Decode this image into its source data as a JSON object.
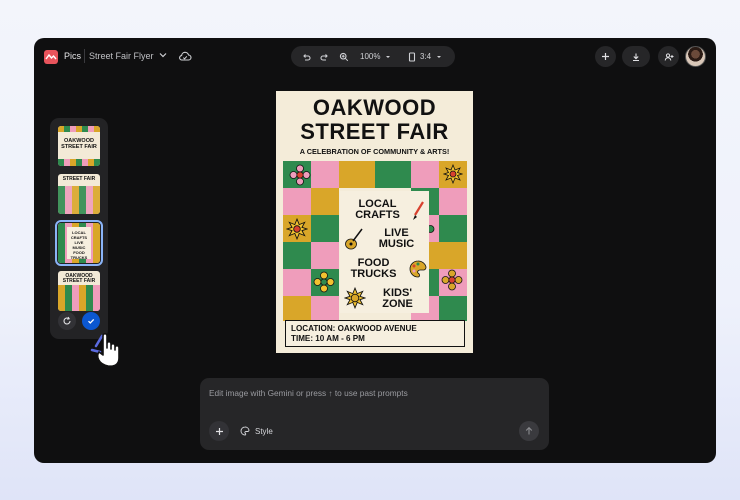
{
  "header": {
    "app_name": "Pics",
    "doc_title": "Street Fair Flyer",
    "zoom": "100%",
    "aspect": "3:4"
  },
  "icons": {
    "logo": "pics-logo-icon",
    "doc_menu": "chevron-down-icon",
    "sync": "cloud-icon",
    "undo": "undo-icon",
    "redo": "redo-icon",
    "zoom": "zoom-in-icon",
    "aspect": "portrait-icon",
    "add": "plus-icon",
    "download": "download-icon",
    "share": "add-person-icon",
    "regenerate": "refresh-icon",
    "apply": "check-icon",
    "send": "arrow-up-icon",
    "style": "palette-icon"
  },
  "thumbnails": [
    {
      "title": "OAKWOOD STREET FAIR",
      "selected": false
    },
    {
      "title": "STREET FAIR",
      "selected": false
    },
    {
      "title": "LOCAL CRAFTS LIVE MUSIC FOOD TRUCKS",
      "selected": true
    },
    {
      "title": "OAKWOOD STREET FAIR",
      "selected": false
    }
  ],
  "flyer": {
    "title_line1": "OAKWOOD",
    "title_line2": "STREET FAIR",
    "subtitle": "A CELEBRATION OF COMMUNITY & ARTS!",
    "item1_a": "LOCAL",
    "item1_b": "CRAFTS",
    "item2_a": "LIVE",
    "item2_b": "MUSIC",
    "item3_a": "FOOD",
    "item3_b": "TRUCKS",
    "item4_a": "KIDS'",
    "item4_b": "ZONE",
    "location": "LOCATION: OAKWOOD AVENUE",
    "time": "TIME: 10 AM - 6 PM"
  },
  "prompt": {
    "placeholder": "Edit image with Gemini or press ↑ to use past prompts",
    "style_label": "Style"
  },
  "colors": {
    "accent_blue": "#0b57d0",
    "selection": "#8ab4f8",
    "flyer_green": "#2f8a4e",
    "flyer_pink": "#ef9dbb",
    "flyer_yellow": "#d9a629",
    "flyer_red": "#d8412f"
  }
}
